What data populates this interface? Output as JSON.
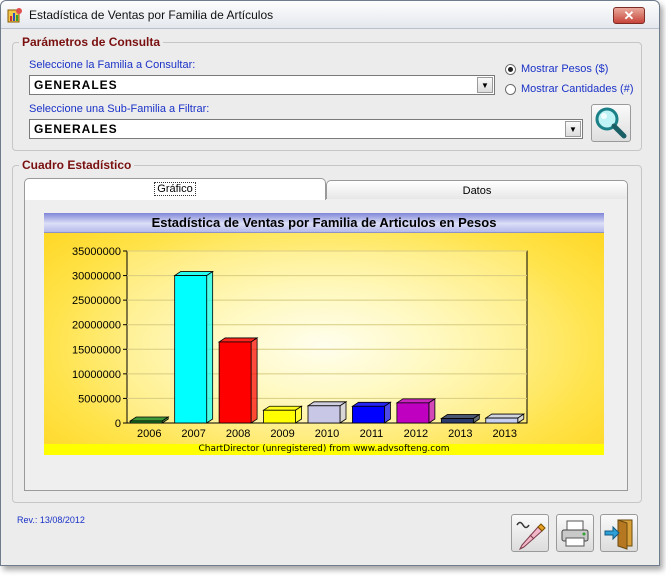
{
  "window": {
    "title": "Estadística de Ventas por Familia de Artículos",
    "close_label": "✕"
  },
  "params": {
    "legend": "Parámetros de Consulta",
    "family_label": "Seleccione la Familia a Consultar:",
    "family_value": "GENERALES",
    "subfamily_label": "Seleccione una Sub-Familia a Filtrar:",
    "subfamily_value": "GENERALES",
    "radio_pesos": "Mostrar Pesos ($)",
    "radio_cantidades": "Mostrar Cantidades (#)",
    "selected_mode": "pesos"
  },
  "stats": {
    "legend": "Cuadro Estadístico",
    "tabs": [
      {
        "label": "Gráfico",
        "active": true
      },
      {
        "label": "Datos",
        "active": false
      }
    ]
  },
  "chart_data": {
    "type": "bar",
    "title": "Estadística de Ventas por Familia de Articulos en Pesos",
    "categories": [
      "2006",
      "2007",
      "2008",
      "2009",
      "2010",
      "2011",
      "2012",
      "2013",
      "2013"
    ],
    "values": [
      300000,
      30000000,
      16500000,
      2600000,
      3500000,
      3400000,
      4100000,
      900000,
      1000000
    ],
    "colors": [
      "#1f8a2a",
      "#00ffff",
      "#ff0000",
      "#ffff00",
      "#c8c8e6",
      "#0000ff",
      "#c000c0",
      "#2a3a6a",
      "#c8d0f0"
    ],
    "y_ticks": [
      "35000000",
      "30000000",
      "25000000",
      "20000000",
      "15000000",
      "10000000",
      "5000000",
      "0"
    ],
    "ylim": [
      0,
      35000000
    ],
    "footer": "ChartDirector (unregistered) from www.advsofteng.com"
  },
  "footer": {
    "revision": "Rev.: 13/08/2012"
  },
  "icons": {
    "app": "app-icon",
    "search": "magnifier-icon",
    "edit": "pencil-icon",
    "print": "printer-icon",
    "exit": "exit-door-icon"
  }
}
